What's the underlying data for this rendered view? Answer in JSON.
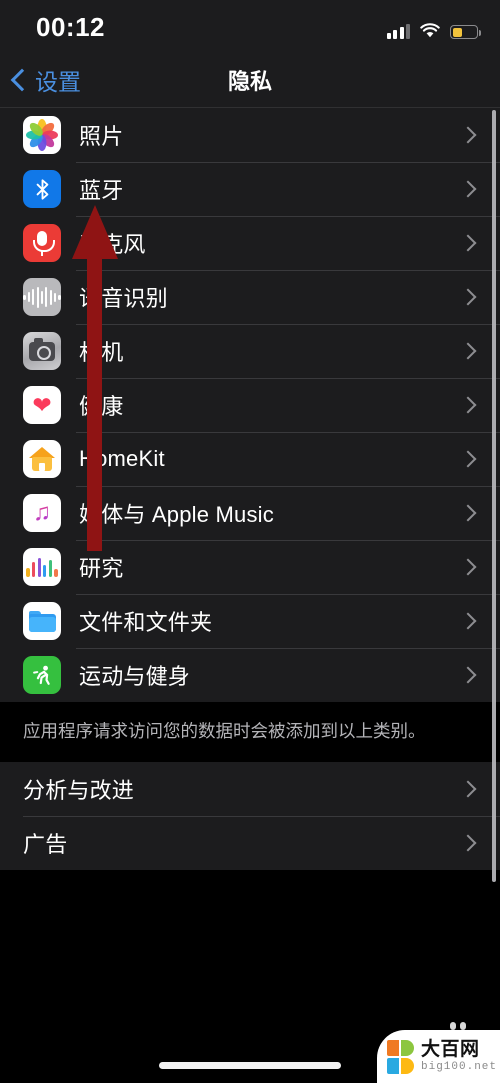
{
  "status_bar": {
    "time": "00:12",
    "signal_icon": "cellular-signal-icon",
    "wifi_icon": "wifi-icon",
    "battery_icon": "battery-low-power-icon",
    "battery_color": "#f2c33c"
  },
  "nav": {
    "back_label": "设置",
    "back_icon": "chevron-left-icon",
    "title": "隐私",
    "tint_color": "#4a8fe0"
  },
  "sections": [
    {
      "id": "privacy-categories",
      "rows": [
        {
          "label": "照片",
          "icon": "photos-icon",
          "chevron": "chevron-right-icon"
        },
        {
          "label": "蓝牙",
          "icon": "bluetooth-icon",
          "chevron": "chevron-right-icon"
        },
        {
          "label": "麦克风",
          "icon": "microphone-icon",
          "chevron": "chevron-right-icon"
        },
        {
          "label": "语音识别",
          "icon": "speech-recognition-icon",
          "chevron": "chevron-right-icon"
        },
        {
          "label": "相机",
          "icon": "camera-icon",
          "chevron": "chevron-right-icon"
        },
        {
          "label": "健康",
          "icon": "health-icon",
          "chevron": "chevron-right-icon"
        },
        {
          "label": "HomeKit",
          "icon": "homekit-icon",
          "chevron": "chevron-right-icon"
        },
        {
          "label": "媒体与 Apple Music",
          "icon": "apple-music-icon",
          "chevron": "chevron-right-icon"
        },
        {
          "label": "研究",
          "icon": "research-icon",
          "chevron": "chevron-right-icon"
        },
        {
          "label": "文件和文件夹",
          "icon": "files-icon",
          "chevron": "chevron-right-icon"
        },
        {
          "label": "运动与健身",
          "icon": "motion-fitness-icon",
          "chevron": "chevron-right-icon"
        }
      ],
      "footnote": "应用程序请求访问您的数据时会被添加到以上类别。"
    },
    {
      "id": "privacy-other",
      "rows": [
        {
          "label": "分析与改进",
          "icon": "",
          "chevron": "chevron-right-icon"
        },
        {
          "label": "广告",
          "icon": "",
          "chevron": "chevron-right-icon"
        }
      ]
    }
  ],
  "annotation": {
    "arrow_icon": "red-up-arrow-annotation",
    "color": "#8f1414",
    "points_at": "蓝牙"
  },
  "watermark": {
    "name_cn": "大百网",
    "name_en": "big100.net",
    "logo_colors": [
      "#f07a22",
      "#8cc63f",
      "#29a9e1",
      "#fdb913"
    ]
  },
  "home_indicator": "home-indicator-bar"
}
